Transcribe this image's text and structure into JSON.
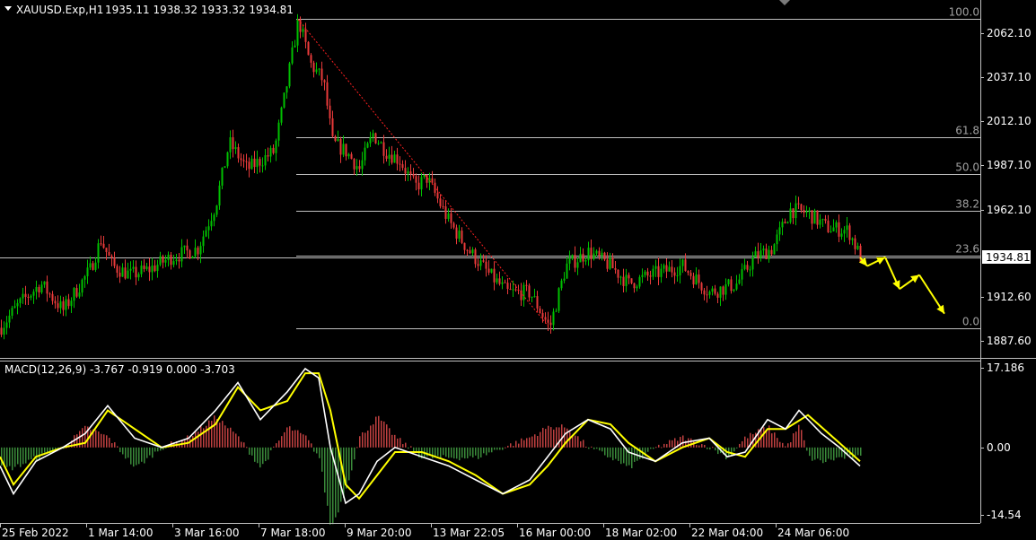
{
  "main_chart": {
    "symbol": "XAUUSD.Exp,H1",
    "ohlc": "1935.11 1938.32 1933.32 1934.81",
    "current_price": "1934.81",
    "price_ticks": [
      "2062.10",
      "2037.10",
      "2012.10",
      "1987.10",
      "1962.10",
      "1912.60",
      "1887.60"
    ],
    "time_labels": [
      "25 Feb 2022",
      "1 Mar 14:00",
      "3 Mar 16:00",
      "7 Mar 18:00",
      "9 Mar 20:00",
      "13 Mar 22:05",
      "16 Mar 00:00",
      "18 Mar 02:00",
      "22 Mar 04:00",
      "24 Mar 06:00"
    ]
  },
  "fibonacci": {
    "high": 2070.0,
    "low": 1894.5,
    "levels": [
      {
        "label": "100.0",
        "ratio": 1.0
      },
      {
        "label": "61.8",
        "ratio": 0.618
      },
      {
        "label": "50.0",
        "ratio": 0.5
      },
      {
        "label": "38.2",
        "ratio": 0.382
      },
      {
        "label": "23.6",
        "ratio": 0.236
      },
      {
        "label": "0.0",
        "ratio": 0.0
      }
    ]
  },
  "macd": {
    "title": "MACD(12,26,9) -3.767 -0.919 0.000 -3.703",
    "ticks": [
      "17.186",
      "0.00",
      "-14.54"
    ]
  },
  "colors": {
    "background": "#000000",
    "bull": "#00c000",
    "bear": "#e83a3a",
    "grid": "#c0c0c0",
    "trend": "#ff2020",
    "arrow": "#ffff00",
    "macd_line": "#ffffff",
    "signal_line": "#ffff00",
    "hist_pos": "#c04040",
    "hist_neg": "#3a8a3a"
  },
  "chart_data": [
    {
      "type": "candlestick",
      "title": "XAUUSD.Exp,H1",
      "ylim": [
        1880,
        2085
      ],
      "x": [
        "25 Feb 2022",
        "1 Mar 14:00",
        "3 Mar 16:00",
        "7 Mar 18:00",
        "9 Mar 20:00",
        "13 Mar 22:05",
        "16 Mar 00:00",
        "18 Mar 02:00",
        "22 Mar 04:00",
        "24 Mar 06:00"
      ],
      "close_path": [
        [
          0,
          1895
        ],
        [
          20,
          1908
        ],
        [
          45,
          1920
        ],
        [
          70,
          1905
        ],
        [
          100,
          1928
        ],
        [
          112,
          1945
        ],
        [
          125,
          1930
        ],
        [
          145,
          1925
        ],
        [
          165,
          1928
        ],
        [
          190,
          1935
        ],
        [
          220,
          1940
        ],
        [
          240,
          1965
        ],
        [
          255,
          2000
        ],
        [
          275,
          1985
        ],
        [
          305,
          1995
        ],
        [
          318,
          2030
        ],
        [
          332,
          2070
        ],
        [
          345,
          2045
        ],
        [
          360,
          2035
        ],
        [
          370,
          2000
        ],
        [
          385,
          1995
        ],
        [
          400,
          1985
        ],
        [
          415,
          2005
        ],
        [
          430,
          1995
        ],
        [
          445,
          1990
        ],
        [
          462,
          1975
        ],
        [
          475,
          1980
        ],
        [
          500,
          1955
        ],
        [
          520,
          1940
        ],
        [
          545,
          1925
        ],
        [
          565,
          1915
        ],
        [
          590,
          1915
        ],
        [
          612,
          1895
        ],
        [
          630,
          1930
        ],
        [
          655,
          1938
        ],
        [
          680,
          1930
        ],
        [
          700,
          1920
        ],
        [
          725,
          1925
        ],
        [
          760,
          1930
        ],
        [
          790,
          1915
        ],
        [
          820,
          1920
        ],
        [
          840,
          1935
        ],
        [
          860,
          1940
        ],
        [
          880,
          1962
        ],
        [
          900,
          1960
        ],
        [
          920,
          1952
        ],
        [
          945,
          1950
        ],
        [
          958,
          1935
        ]
      ],
      "forecast_path": [
        [
          958,
          1935
        ],
        [
          966,
          1930
        ],
        [
          986,
          1935
        ],
        [
          1002,
          1917
        ],
        [
          1024,
          1925
        ],
        [
          1052,
          1903
        ]
      ]
    },
    {
      "type": "line",
      "title": "MACD(12,26,9) -3.767 -0.919 0.000 -3.703",
      "ylim": [
        -14.54,
        17.186
      ],
      "series": [
        {
          "name": "MACD",
          "values": [
            [
              0,
              -4
            ],
            [
              15,
              -10
            ],
            [
              40,
              -3
            ],
            [
              70,
              0
            ],
            [
              95,
              3
            ],
            [
              120,
              9
            ],
            [
              150,
              2
            ],
            [
              180,
              0
            ],
            [
              210,
              2
            ],
            [
              240,
              8
            ],
            [
              265,
              14
            ],
            [
              290,
              6
            ],
            [
              320,
              12
            ],
            [
              340,
              17
            ],
            [
              355,
              15
            ],
            [
              368,
              0
            ],
            [
              385,
              -12
            ],
            [
              400,
              -10
            ],
            [
              420,
              -3
            ],
            [
              440,
              0
            ],
            [
              470,
              -2
            ],
            [
              500,
              -4
            ],
            [
              530,
              -7
            ],
            [
              560,
              -10
            ],
            [
              590,
              -7
            ],
            [
              610,
              -2
            ],
            [
              630,
              3
            ],
            [
              655,
              6
            ],
            [
              680,
              4
            ],
            [
              700,
              -1
            ],
            [
              730,
              -3
            ],
            [
              760,
              1
            ],
            [
              790,
              2
            ],
            [
              810,
              -2
            ],
            [
              830,
              -1
            ],
            [
              855,
              6
            ],
            [
              875,
              4
            ],
            [
              890,
              8
            ],
            [
              915,
              3
            ],
            [
              935,
              0
            ],
            [
              958,
              -4
            ]
          ]
        },
        {
          "name": "Signal",
          "values": [
            [
              0,
              -2
            ],
            [
              15,
              -8
            ],
            [
              40,
              -2
            ],
            [
              70,
              0
            ],
            [
              95,
              1
            ],
            [
              120,
              8
            ],
            [
              150,
              4
            ],
            [
              180,
              0
            ],
            [
              210,
              1
            ],
            [
              240,
              5
            ],
            [
              265,
              13
            ],
            [
              290,
              8
            ],
            [
              320,
              10
            ],
            [
              340,
              16
            ],
            [
              355,
              16
            ],
            [
              368,
              8
            ],
            [
              385,
              -8
            ],
            [
              400,
              -11
            ],
            [
              420,
              -6
            ],
            [
              440,
              -1
            ],
            [
              470,
              -1
            ],
            [
              500,
              -3
            ],
            [
              530,
              -6
            ],
            [
              560,
              -10
            ],
            [
              590,
              -8
            ],
            [
              610,
              -4
            ],
            [
              630,
              1
            ],
            [
              655,
              6
            ],
            [
              680,
              5
            ],
            [
              700,
              1
            ],
            [
              730,
              -3
            ],
            [
              760,
              0
            ],
            [
              790,
              2
            ],
            [
              810,
              -1
            ],
            [
              830,
              -2
            ],
            [
              855,
              4
            ],
            [
              875,
              4
            ],
            [
              900,
              7
            ],
            [
              935,
              1
            ],
            [
              958,
              -3
            ]
          ]
        }
      ]
    }
  ]
}
